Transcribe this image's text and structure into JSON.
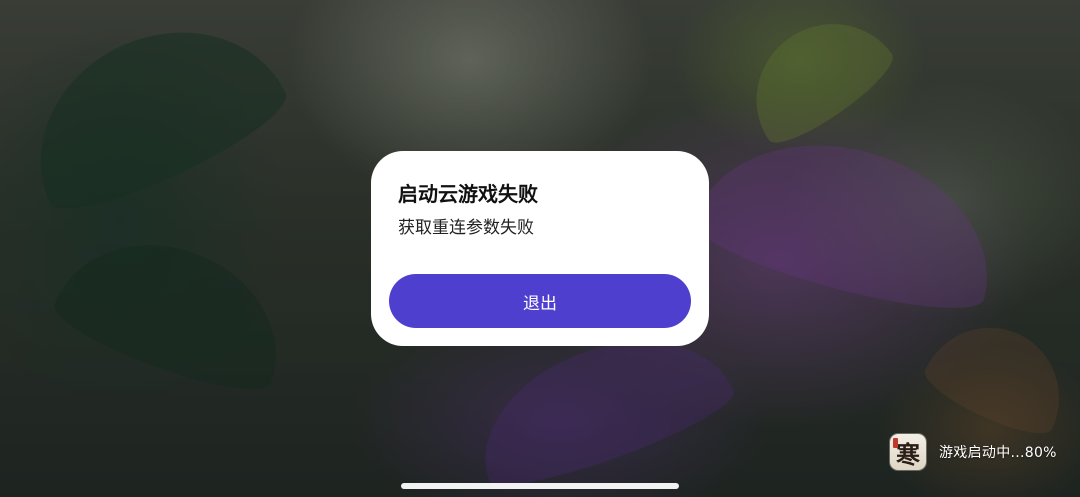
{
  "dialog": {
    "title": "启动云游戏失败",
    "message": "获取重连参数失败",
    "exit_label": "退出"
  },
  "launch_status": {
    "app_icon_glyph": "寒",
    "text": "游戏启动中...80%",
    "progress_percent": 80
  },
  "colors": {
    "accent": "#4f3fcf",
    "dialog_background": "#ffffff",
    "home_indicator": "#f2f2f2"
  },
  "icons": {
    "app_icon": "game-app-icon"
  }
}
